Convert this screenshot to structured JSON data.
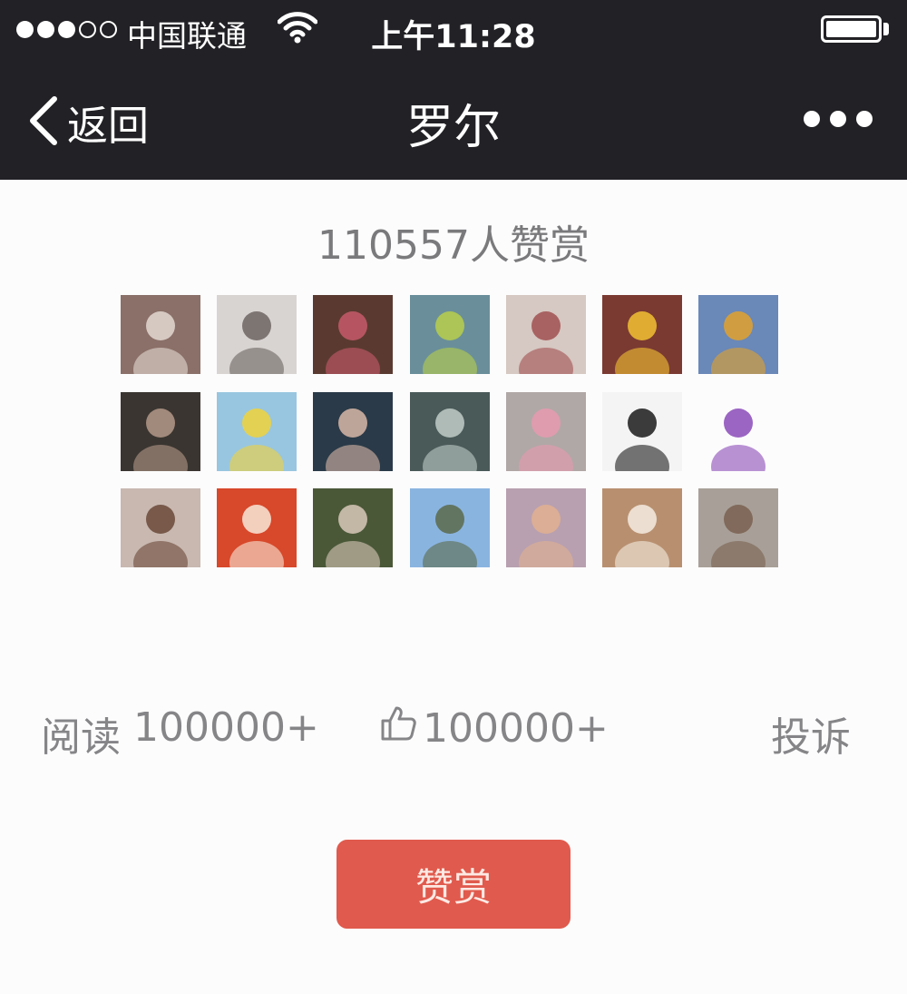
{
  "status_bar": {
    "carrier": "中国联通",
    "time": "上午11:28",
    "signal_icon": "signal-dots-icon",
    "wifi_icon": "wifi-icon",
    "battery_icon": "battery-icon",
    "battery_level": 1.0
  },
  "nav": {
    "back_label": "返回",
    "title": "罗尔",
    "back_icon": "chevron-left-icon",
    "more_icon": "more-dots-icon"
  },
  "reward": {
    "count_text": "110557人赞赏",
    "avatars": [
      {
        "desc": "avatar-woman-with-puppy",
        "bg": "#8a7068",
        "fg": "#e3d8d2"
      },
      {
        "desc": "avatar-pencil-portrait",
        "bg": "#d8d4d2",
        "fg": "#6d6461"
      },
      {
        "desc": "avatar-woman-red-scarf",
        "bg": "#5a3a30",
        "fg": "#c75a6a"
      },
      {
        "desc": "avatar-woman-outdoors",
        "bg": "#6a8f9a",
        "fg": "#b7cf4a"
      },
      {
        "desc": "avatar-text-image",
        "bg": "#d6c8c2",
        "fg": "#a05050"
      },
      {
        "desc": "avatar-yellow-duck",
        "bg": "#7a3a32",
        "fg": "#f2c232"
      },
      {
        "desc": "avatar-yellow-flowers",
        "bg": "#6a88b8",
        "fg": "#e2a22a"
      },
      {
        "desc": "avatar-family-photo",
        "bg": "#3a3530",
        "fg": "#b49888"
      },
      {
        "desc": "avatar-sunflower-sky",
        "bg": "#98c6e0",
        "fg": "#f0d23a"
      },
      {
        "desc": "avatar-two-girls",
        "bg": "#2a3a48",
        "fg": "#d8b8a8"
      },
      {
        "desc": "avatar-glass-vase",
        "bg": "#4a5a58",
        "fg": "#c0ccc8"
      },
      {
        "desc": "avatar-pink-shoes",
        "bg": "#b0a8a6",
        "fg": "#e89ab0"
      },
      {
        "desc": "avatar-panda",
        "bg": "#f4f4f4",
        "fg": "#1a1a1a"
      },
      {
        "desc": "avatar-cartoon-boy",
        "bg": "#fdfcfd",
        "fg": "#8a4ab8"
      },
      {
        "desc": "avatar-smiling-girl",
        "bg": "#c8b8b0",
        "fg": "#6a4838"
      },
      {
        "desc": "avatar-orange-qr-card",
        "bg": "#d8482a",
        "fg": "#f8e8d8"
      },
      {
        "desc": "avatar-child-hat",
        "bg": "#4a5838",
        "fg": "#d8c8b8"
      },
      {
        "desc": "avatar-blue-sky",
        "bg": "#8ab4e0",
        "fg": "#5a6a4a"
      },
      {
        "desc": "avatar-man-pink-shirt",
        "bg": "#b8a0b0",
        "fg": "#e0b090"
      },
      {
        "desc": "avatar-framed-leaf",
        "bg": "#b89070",
        "fg": "#f4ece0"
      },
      {
        "desc": "avatar-old-man",
        "bg": "#a8a098",
        "fg": "#7a6050"
      }
    ]
  },
  "stats": {
    "reads_label": "阅读",
    "reads_value": "100000+",
    "like_icon": "thumbs-up-icon",
    "likes_value": "100000+",
    "report_label": "投诉"
  },
  "actions": {
    "reward_button": "赞赏"
  },
  "colors": {
    "topbar": "#222125",
    "background": "#fdfcfd",
    "button": "#e05a4d",
    "text_gray": "#858588"
  }
}
